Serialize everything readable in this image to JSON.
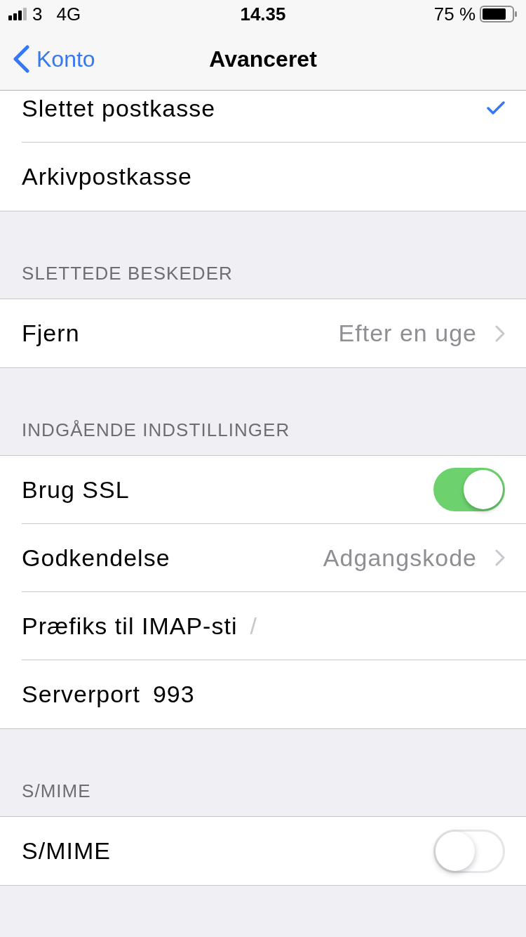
{
  "status_bar": {
    "carrier": "3",
    "network": "4G",
    "time": "14.35",
    "battery": "75 %"
  },
  "nav": {
    "back": "Konto",
    "title": "Avanceret"
  },
  "sections": [
    {
      "rows": [
        {
          "kind": "choice",
          "label": "Slettet postkasse",
          "selected": true
        },
        {
          "kind": "choice",
          "label": "Arkivpostkasse",
          "selected": false
        }
      ]
    },
    {
      "header": "SLETTEDE BESKEDER",
      "rows": [
        {
          "kind": "link",
          "label": "Fjern",
          "value": "Efter en uge"
        }
      ]
    },
    {
      "header": "INDGÅENDE INDSTILLINGER",
      "rows": [
        {
          "kind": "toggle",
          "label": "Brug SSL",
          "on": true
        },
        {
          "kind": "link",
          "label": "Godkendelse",
          "value": "Adgangskode"
        },
        {
          "kind": "field",
          "label": "Præfiks til IMAP-sti",
          "placeholder": "/"
        },
        {
          "kind": "field",
          "label": "Serverport",
          "value": "993"
        }
      ]
    },
    {
      "header": "S/MIME",
      "rows": [
        {
          "kind": "toggle",
          "label": "S/MIME",
          "on": false
        }
      ]
    }
  ]
}
